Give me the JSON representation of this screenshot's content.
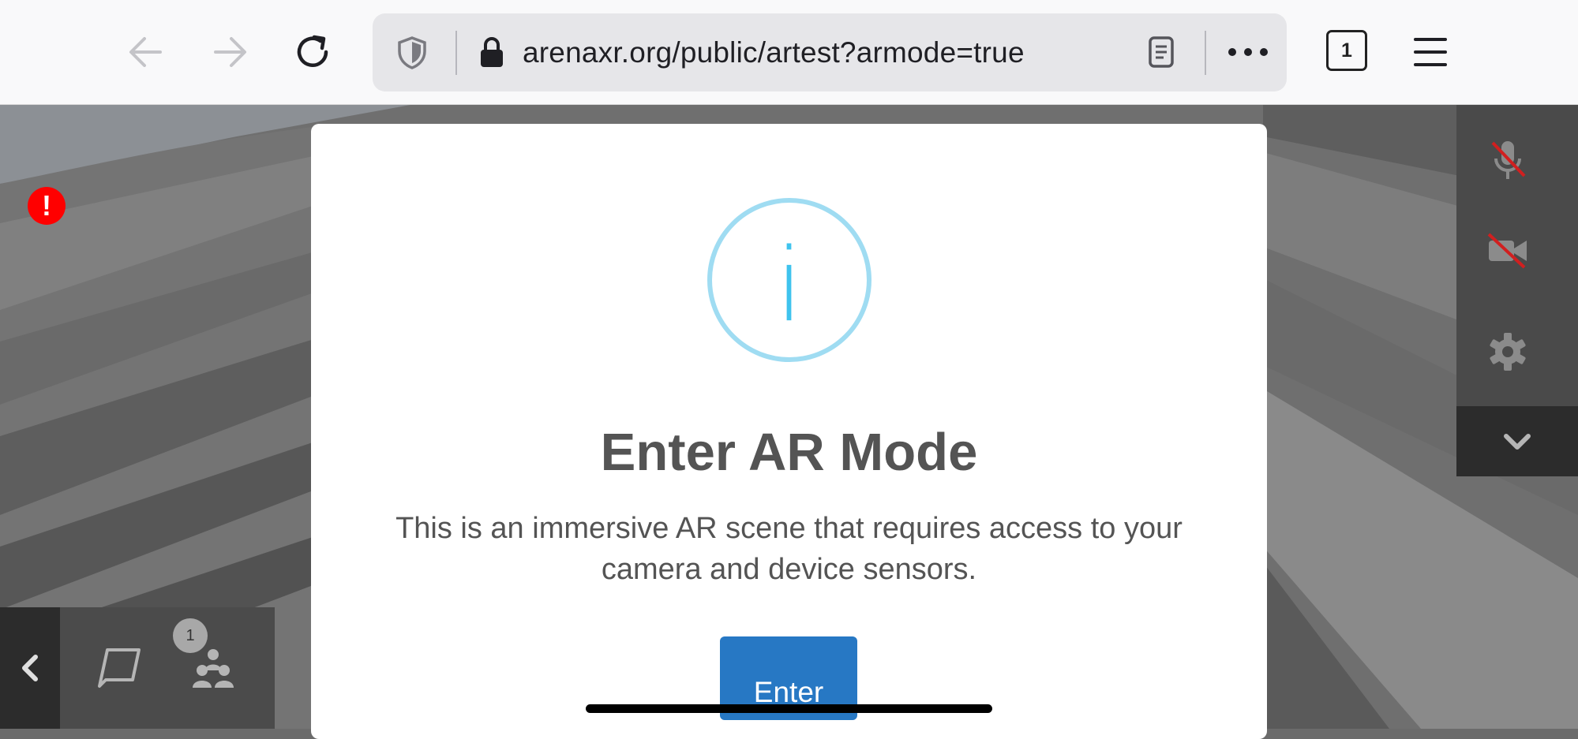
{
  "browser": {
    "url": "arenaxr.org/public/artest?armode=true",
    "tab_count": "1",
    "icons": {
      "back": "arrow-left-icon",
      "forward": "arrow-right-icon",
      "reload": "reload-icon",
      "tracking": "shield-icon",
      "secure": "lock-icon",
      "reader": "reader-view-icon",
      "more": "more-dots-icon",
      "menu": "hamburger-menu-icon"
    }
  },
  "scene": {
    "error_icon": "!",
    "user_count": "1",
    "right_panel": [
      "mic-muted-icon",
      "camera-off-icon",
      "gear-icon",
      "chevron-down-icon"
    ],
    "bottom_panel": [
      "chevron-left-icon",
      "chat-icon",
      "users-icon"
    ]
  },
  "modal": {
    "title": "Enter AR Mode",
    "text": "This is an immersive AR scene that requires access to your camera and device sensors.",
    "button_label": "Enter",
    "info_symbol": "i",
    "colors": {
      "button": "#2778c4",
      "info": "#3fc3ee"
    }
  }
}
